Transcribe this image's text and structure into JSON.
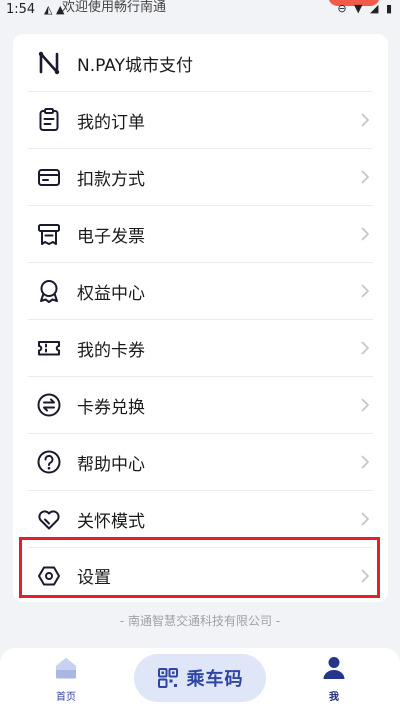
{
  "status_bar": {
    "time": "1:54",
    "toast": "欢迎使用畅行南通"
  },
  "menu": {
    "items": [
      {
        "id": "npay",
        "label": "N.PAY城市支付",
        "icon": "n-logo-icon",
        "chevron": false
      },
      {
        "id": "orders",
        "label": "我的订单",
        "icon": "clipboard-icon",
        "chevron": true
      },
      {
        "id": "payment",
        "label": "扣款方式",
        "icon": "card-icon",
        "chevron": true
      },
      {
        "id": "invoice",
        "label": "电子发票",
        "icon": "receipt-icon",
        "chevron": true
      },
      {
        "id": "benefits",
        "label": "权益中心",
        "icon": "badge-icon",
        "chevron": true
      },
      {
        "id": "coupons",
        "label": "我的卡券",
        "icon": "ticket-icon",
        "chevron": true
      },
      {
        "id": "exchange",
        "label": "卡券兑换",
        "icon": "swap-icon",
        "chevron": true
      },
      {
        "id": "help",
        "label": "帮助中心",
        "icon": "question-icon",
        "chevron": true
      },
      {
        "id": "care",
        "label": "关怀模式",
        "icon": "heart-icon",
        "chevron": true
      },
      {
        "id": "settings",
        "label": "设置",
        "icon": "hexagon-gear-icon",
        "chevron": true
      }
    ]
  },
  "footer": {
    "company": "- 南通智慧交通科技有限公司 -"
  },
  "bottom_nav": {
    "home_label": "首页",
    "ride_code_label": "乘车码",
    "me_label": "我"
  },
  "colors": {
    "accent": "#2d46a3",
    "highlight": "#e0202a",
    "background": "#f2f3f7"
  }
}
